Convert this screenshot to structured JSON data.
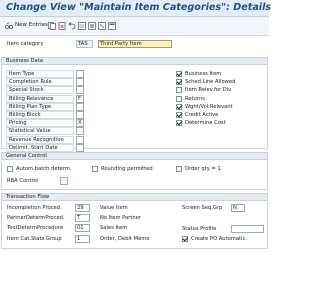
{
  "title": "Change View \"Maintain Item Categories\": Details",
  "toolbar": {
    "new_entries": "New Entries"
  },
  "item_category": {
    "label": "Item category",
    "code": "TAS",
    "description": "Third Party Item"
  },
  "business_data": {
    "header": "Business Data",
    "left": [
      {
        "label": "Item Type",
        "value": ""
      },
      {
        "label": "Completion Rule",
        "value": ""
      },
      {
        "label": "Special Stock",
        "value": ""
      },
      {
        "label": "Billing Relevance",
        "value": "F"
      },
      {
        "label": "Billing Plan Type",
        "value": ""
      },
      {
        "label": "Billing Block",
        "value": ""
      },
      {
        "label": "Pricing",
        "value": "X"
      },
      {
        "label": "Statistical Value",
        "value": ""
      },
      {
        "label": "Revenue Recognition",
        "value": ""
      },
      {
        "label": "Delimit. Start Date",
        "value": ""
      }
    ],
    "right": [
      {
        "label": "Business Item",
        "checked": true
      },
      {
        "label": "Sched.Line Allowed",
        "checked": true
      },
      {
        "label": "Item Relev.for Dlv",
        "checked": false
      },
      {
        "label": "Returns",
        "checked": false
      },
      {
        "label": "Wght/Vol.Relevant",
        "checked": true
      },
      {
        "label": "Credit Active",
        "checked": true
      },
      {
        "label": "Determine Cost",
        "checked": true
      }
    ]
  },
  "general_control": {
    "header": "General Control",
    "autom_batch": {
      "label": "Autom.batch determ.",
      "checked": false
    },
    "rounding": {
      "label": "Rounding permitted",
      "checked": false
    },
    "order_qty": {
      "label": "Order qty = 1",
      "checked": false
    },
    "rba": {
      "label": "RBA Control",
      "value": ""
    }
  },
  "transaction_flow": {
    "header": "Transaction Flow",
    "rows": [
      {
        "label": "Incompletion Proced.",
        "code": "29",
        "text": "Value Item"
      },
      {
        "label": "PartnerDetermProced.",
        "code": "T",
        "text": "No Item Partner"
      },
      {
        "label": "TextDetermProcedure",
        "code": "01",
        "text": "Sales Item"
      },
      {
        "label": "Item Cat.Stats.Group",
        "code": "1",
        "text": "Order, Debit Memo"
      }
    ],
    "screen_seq": {
      "label": "Screen Seq.Grp",
      "value": "N"
    },
    "status_profile": {
      "label": "Status Profile",
      "value": ""
    },
    "create_po": {
      "label": "Create PO Automatic.",
      "checked": true
    }
  },
  "colors": {
    "title": "#1e4f86",
    "titlebar": "#e4ecf5",
    "section": "#e6ebf1"
  }
}
